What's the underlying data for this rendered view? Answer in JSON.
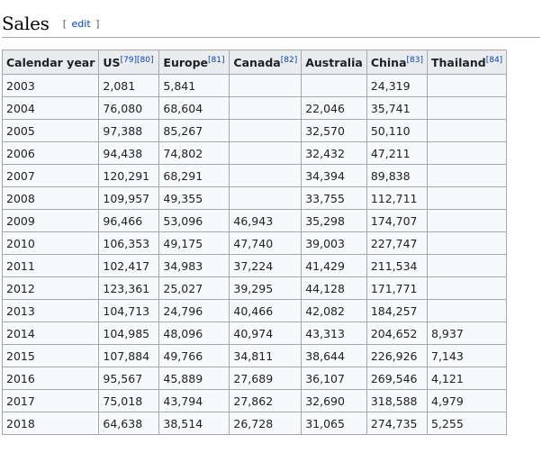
{
  "section": {
    "title": "Sales",
    "edit_open": "[",
    "edit_label": "edit",
    "edit_close": "]"
  },
  "table": {
    "headers": [
      {
        "label": "Calendar year",
        "ref": ""
      },
      {
        "label": "US",
        "ref": "[79][80]"
      },
      {
        "label": "Europe",
        "ref": "[81]"
      },
      {
        "label": "Canada",
        "ref": "[82]"
      },
      {
        "label": "Australia",
        "ref": ""
      },
      {
        "label": "China",
        "ref": "[83]"
      },
      {
        "label": "Thailand",
        "ref": "[84]"
      }
    ],
    "rows": [
      [
        "2003",
        "2,081",
        "5,841",
        "",
        "",
        "24,319",
        ""
      ],
      [
        "2004",
        "76,080",
        "68,604",
        "",
        "22,046",
        "35,741",
        ""
      ],
      [
        "2005",
        "97,388",
        "85,267",
        "",
        "32,570",
        "50,110",
        ""
      ],
      [
        "2006",
        "94,438",
        "74,802",
        "",
        "32,432",
        "47,211",
        ""
      ],
      [
        "2007",
        "120,291",
        "68,291",
        "",
        "34,394",
        "89,838",
        ""
      ],
      [
        "2008",
        "109,957",
        "49,355",
        "",
        "33,755",
        "112,711",
        ""
      ],
      [
        "2009",
        "96,466",
        "53,096",
        "46,943",
        "35,298",
        "174,707",
        ""
      ],
      [
        "2010",
        "106,353",
        "49,175",
        "47,740",
        "39,003",
        "227,747",
        ""
      ],
      [
        "2011",
        "102,417",
        "34,983",
        "37,224",
        "41,429",
        "211,534",
        ""
      ],
      [
        "2012",
        "123,361",
        "25,027",
        "39,295",
        "44,128",
        "171,771",
        ""
      ],
      [
        "2013",
        "104,713",
        "24,796",
        "40,466",
        "42,082",
        "184,257",
        ""
      ],
      [
        "2014",
        "104,985",
        "48,096",
        "40,974",
        "43,313",
        "204,652",
        "8,937"
      ],
      [
        "2015",
        "107,884",
        "49,766",
        "34,811",
        "38,644",
        "226,926",
        "7,143"
      ],
      [
        "2016",
        "95,567",
        "45,889",
        "27,689",
        "36,107",
        "269,546",
        "4,121"
      ],
      [
        "2017",
        "75,018",
        "43,794",
        "27,862",
        "32,690",
        "318,588",
        "4,979"
      ],
      [
        "2018",
        "64,638",
        "38,514",
        "26,728",
        "31,065",
        "274,735",
        "5,255"
      ]
    ]
  },
  "colors": {
    "header_bg": "#eaecf0",
    "cell_bg": "#f8f9fa",
    "border": "#a2a9b1",
    "link": "#0645ad"
  }
}
